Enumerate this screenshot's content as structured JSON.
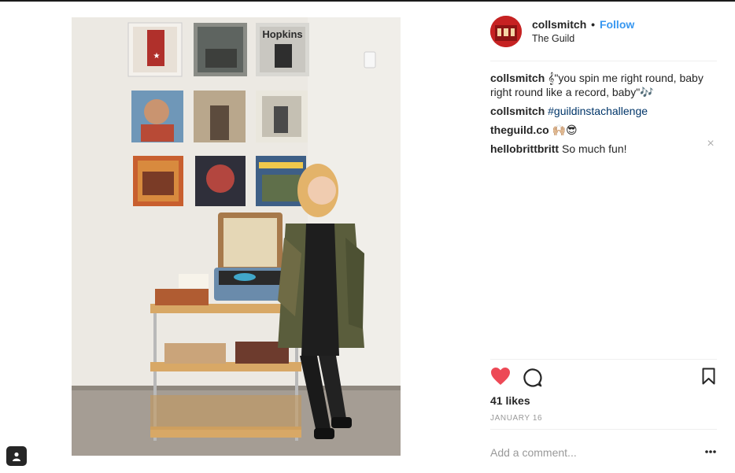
{
  "post": {
    "username": "collsmitch",
    "separator": "•",
    "follow_label": "Follow",
    "location": "The Guild",
    "likes": "41 likes",
    "date": "JANUARY 16"
  },
  "caption": {
    "username": "collsmitch",
    "lines": [
      "𝄞\"you spin me right round, baby",
      "right round like a record, baby\"🎶"
    ]
  },
  "comments": [
    {
      "username": "collsmitch",
      "text": "#guildinstachallenge"
    },
    {
      "username": "theguild.co",
      "text": "🙌🏼😎"
    },
    {
      "username": "hellobrittbritt",
      "text": "So much fun!"
    }
  ],
  "record_covers": [
    "Hopkins"
  ],
  "add_comment": {
    "placeholder": "Add a comment..."
  },
  "icons": {
    "like": "heart-icon",
    "comment": "comment-bubble-icon",
    "save": "bookmark-icon",
    "more": "more-options-icon",
    "close": "close-icon",
    "tag": "user-tag-icon"
  },
  "colors": {
    "link_blue": "#3897f0",
    "hashtag": "#003569",
    "like_red": "#ed4956",
    "muted": "#999999"
  }
}
